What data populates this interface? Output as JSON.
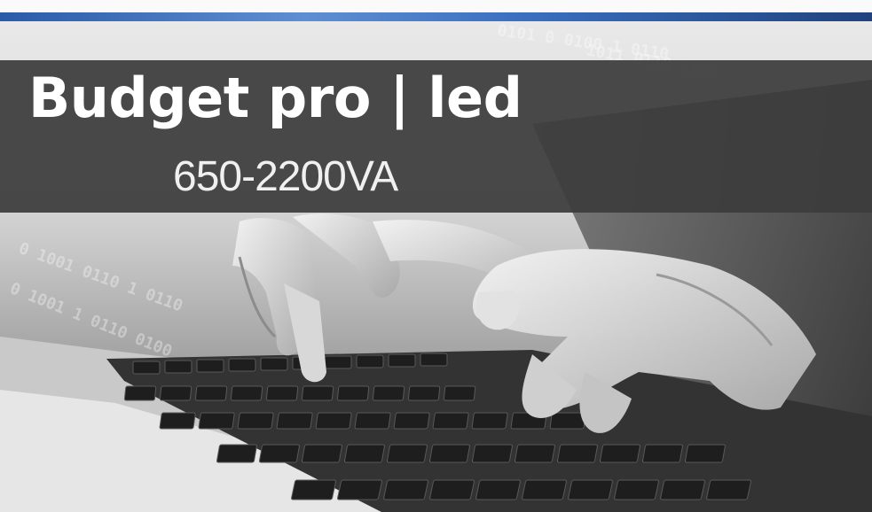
{
  "banner": {
    "title": "Budget pro | led",
    "subtitle": "650-2200VA"
  },
  "colors": {
    "banner_bg": "#3c3c3c",
    "accent_blue": "#3a6fc0",
    "text": "#ffffff"
  },
  "image": {
    "description_icon": "hands-typing-on-laptop-keyboard-photo"
  }
}
